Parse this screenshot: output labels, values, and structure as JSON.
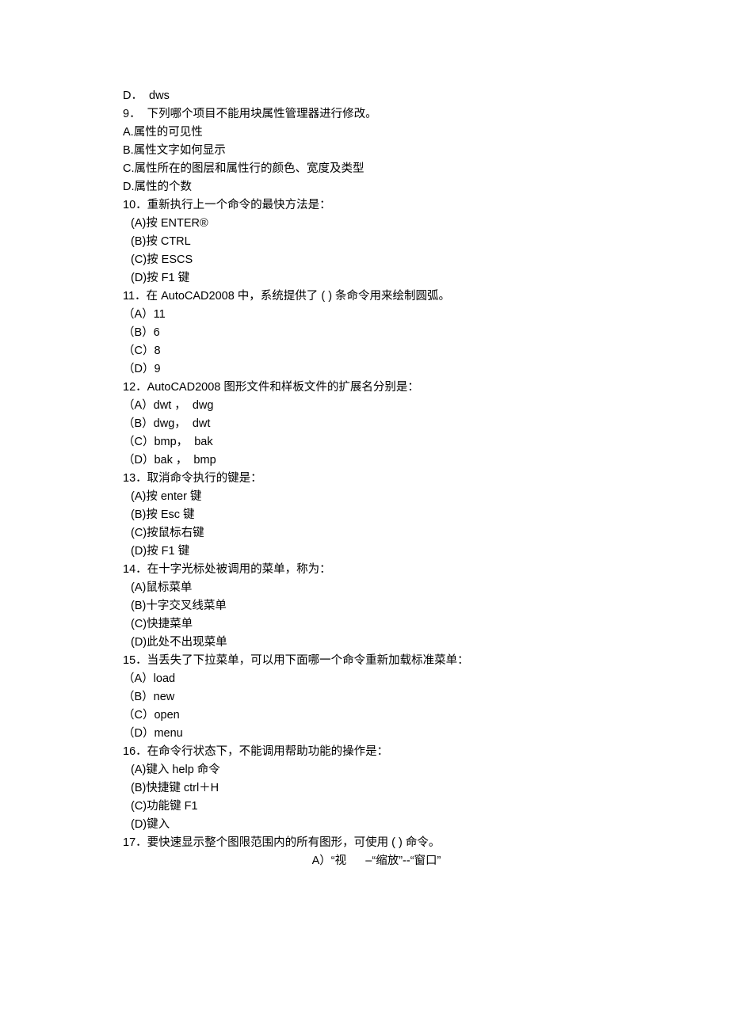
{
  "lines": {
    "l0": "D．  dws",
    "l1": "9．  下列哪个项目不能用块属性管理器进行修改。",
    "l2": "A.属性的可见性",
    "l3": "B.属性文字如何显示",
    "l4": "C.属性所在的图层和属性行的颜色、宽度及类型",
    "l5": "D.属性的个数",
    "l6": "10．重新执行上一个命令的最快方法是：",
    "l7": "(A)按 ENTER®",
    "l8": "(B)按 CTRL",
    "l9": "(C)按 ESCS",
    "l10": "(D)按 F1 键",
    "l11": "11．在 AutoCAD2008 中，系统提供了 ( ) 条命令用来绘制圆弧。",
    "l12": "（A）11",
    "l13": "（B）6",
    "l14": "（C）8",
    "l15": "（D）9",
    "l16": "12．AutoCAD2008 图形文件和样板文件的扩展名分别是：",
    "l17": "（A）dwt ，  dwg",
    "l18": "（B）dwg，  dwt",
    "l19": "（C）bmp，  bak",
    "l20": "（D）bak ，  bmp",
    "l21": "13．取消命令执行的键是：",
    "l22": "(A)按 enter 键",
    "l23": "(B)按 Esc 键",
    "l24": "(C)按鼠标右键",
    "l25": "(D)按 F1 键",
    "l26": "14．在十字光标处被调用的菜单，称为：",
    "l27": "(A)鼠标菜单",
    "l28": "(B)十字交叉线菜单",
    "l29": "(C)快捷菜单",
    "l30": "(D)此处不出现菜单",
    "l31": "15．当丢失了下拉菜单，可以用下面哪一个命令重新加载标准菜单：",
    "l32": "（A）load",
    "l33": "（B）new",
    "l34": "（C）open",
    "l35": "（D）menu",
    "l36": "16．在命令行状态下，不能调用帮助功能的操作是：",
    "l37": "(A)键入 help 命令",
    "l38": "(B)快捷键 ctrl＋H",
    "l39": "(C)功能键 F1",
    "l40": "(D)键入",
    "l41": "17．要快速显示整个图限范围内的所有图形，可使用 ( ) 命令。",
    "l42": "A）“视      –“缩放”--“窗口”"
  }
}
